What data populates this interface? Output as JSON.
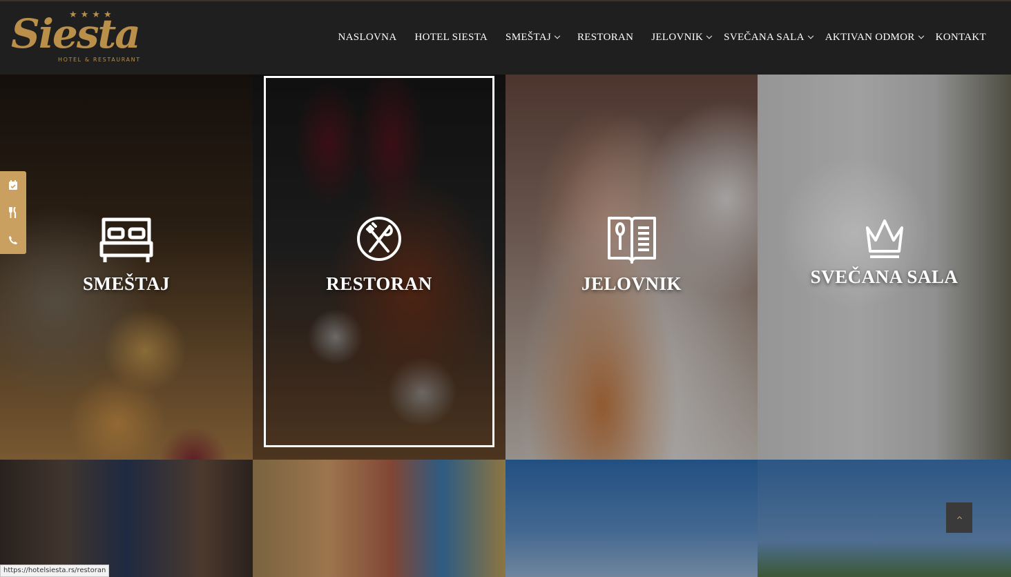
{
  "brand": {
    "name": "Siesta",
    "stars": "★★★★",
    "tagline": "HOTEL & RESTAURANT",
    "gold": "#b98f4a"
  },
  "nav": [
    {
      "label": "NASLOVNA",
      "dropdown": false
    },
    {
      "label": "HOTEL SIESTA",
      "dropdown": false
    },
    {
      "label": "SMEŠTAJ",
      "dropdown": true
    },
    {
      "label": "RESTORAN",
      "dropdown": false
    },
    {
      "label": "JELOVNIK",
      "dropdown": true
    },
    {
      "label": "SVEČANA SALA",
      "dropdown": true
    },
    {
      "label": "AKTIVAN ODMOR",
      "dropdown": true
    },
    {
      "label": "KONTAKT",
      "dropdown": false
    }
  ],
  "tiles": [
    {
      "label": "SMEŠTAJ",
      "icon": "bed-icon"
    },
    {
      "label": "RESTORAN",
      "icon": "fork-knife-icon",
      "active": true
    },
    {
      "label": "JELOVNIK",
      "icon": "menu-book-icon"
    },
    {
      "label": "SVEČANA SALA",
      "icon": "crown-icon"
    }
  ],
  "sidebar": {
    "icons": [
      "calendar-check-icon",
      "restaurant-icon",
      "phone-icon"
    ],
    "color": "#c9a060"
  },
  "scroll_top": {
    "icon": "chevron-up-icon"
  },
  "status_url": "https://hotelsiesta.rs/restoran"
}
